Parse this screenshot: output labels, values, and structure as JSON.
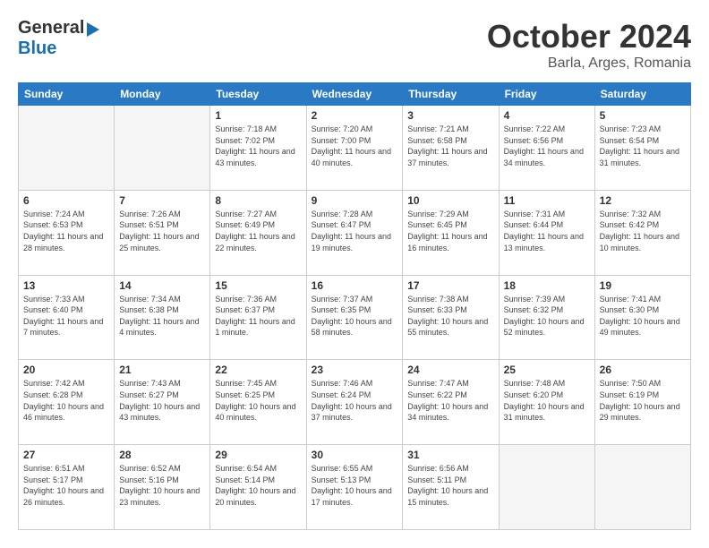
{
  "logo": {
    "general": "General",
    "blue": "Blue",
    "arrow": "arrow"
  },
  "header": {
    "month": "October 2024",
    "location": "Barla, Arges, Romania"
  },
  "days_of_week": [
    "Sunday",
    "Monday",
    "Tuesday",
    "Wednesday",
    "Thursday",
    "Friday",
    "Saturday"
  ],
  "weeks": [
    [
      {
        "day": "",
        "sunrise": "",
        "sunset": "",
        "daylight": "",
        "empty": true
      },
      {
        "day": "",
        "sunrise": "",
        "sunset": "",
        "daylight": "",
        "empty": true
      },
      {
        "day": "1",
        "sunrise": "Sunrise: 7:18 AM",
        "sunset": "Sunset: 7:02 PM",
        "daylight": "Daylight: 11 hours and 43 minutes.",
        "empty": false
      },
      {
        "day": "2",
        "sunrise": "Sunrise: 7:20 AM",
        "sunset": "Sunset: 7:00 PM",
        "daylight": "Daylight: 11 hours and 40 minutes.",
        "empty": false
      },
      {
        "day": "3",
        "sunrise": "Sunrise: 7:21 AM",
        "sunset": "Sunset: 6:58 PM",
        "daylight": "Daylight: 11 hours and 37 minutes.",
        "empty": false
      },
      {
        "day": "4",
        "sunrise": "Sunrise: 7:22 AM",
        "sunset": "Sunset: 6:56 PM",
        "daylight": "Daylight: 11 hours and 34 minutes.",
        "empty": false
      },
      {
        "day": "5",
        "sunrise": "Sunrise: 7:23 AM",
        "sunset": "Sunset: 6:54 PM",
        "daylight": "Daylight: 11 hours and 31 minutes.",
        "empty": false
      }
    ],
    [
      {
        "day": "6",
        "sunrise": "Sunrise: 7:24 AM",
        "sunset": "Sunset: 6:53 PM",
        "daylight": "Daylight: 11 hours and 28 minutes.",
        "empty": false
      },
      {
        "day": "7",
        "sunrise": "Sunrise: 7:26 AM",
        "sunset": "Sunset: 6:51 PM",
        "daylight": "Daylight: 11 hours and 25 minutes.",
        "empty": false
      },
      {
        "day": "8",
        "sunrise": "Sunrise: 7:27 AM",
        "sunset": "Sunset: 6:49 PM",
        "daylight": "Daylight: 11 hours and 22 minutes.",
        "empty": false
      },
      {
        "day": "9",
        "sunrise": "Sunrise: 7:28 AM",
        "sunset": "Sunset: 6:47 PM",
        "daylight": "Daylight: 11 hours and 19 minutes.",
        "empty": false
      },
      {
        "day": "10",
        "sunrise": "Sunrise: 7:29 AM",
        "sunset": "Sunset: 6:45 PM",
        "daylight": "Daylight: 11 hours and 16 minutes.",
        "empty": false
      },
      {
        "day": "11",
        "sunrise": "Sunrise: 7:31 AM",
        "sunset": "Sunset: 6:44 PM",
        "daylight": "Daylight: 11 hours and 13 minutes.",
        "empty": false
      },
      {
        "day": "12",
        "sunrise": "Sunrise: 7:32 AM",
        "sunset": "Sunset: 6:42 PM",
        "daylight": "Daylight: 11 hours and 10 minutes.",
        "empty": false
      }
    ],
    [
      {
        "day": "13",
        "sunrise": "Sunrise: 7:33 AM",
        "sunset": "Sunset: 6:40 PM",
        "daylight": "Daylight: 11 hours and 7 minutes.",
        "empty": false
      },
      {
        "day": "14",
        "sunrise": "Sunrise: 7:34 AM",
        "sunset": "Sunset: 6:38 PM",
        "daylight": "Daylight: 11 hours and 4 minutes.",
        "empty": false
      },
      {
        "day": "15",
        "sunrise": "Sunrise: 7:36 AM",
        "sunset": "Sunset: 6:37 PM",
        "daylight": "Daylight: 11 hours and 1 minute.",
        "empty": false
      },
      {
        "day": "16",
        "sunrise": "Sunrise: 7:37 AM",
        "sunset": "Sunset: 6:35 PM",
        "daylight": "Daylight: 10 hours and 58 minutes.",
        "empty": false
      },
      {
        "day": "17",
        "sunrise": "Sunrise: 7:38 AM",
        "sunset": "Sunset: 6:33 PM",
        "daylight": "Daylight: 10 hours and 55 minutes.",
        "empty": false
      },
      {
        "day": "18",
        "sunrise": "Sunrise: 7:39 AM",
        "sunset": "Sunset: 6:32 PM",
        "daylight": "Daylight: 10 hours and 52 minutes.",
        "empty": false
      },
      {
        "day": "19",
        "sunrise": "Sunrise: 7:41 AM",
        "sunset": "Sunset: 6:30 PM",
        "daylight": "Daylight: 10 hours and 49 minutes.",
        "empty": false
      }
    ],
    [
      {
        "day": "20",
        "sunrise": "Sunrise: 7:42 AM",
        "sunset": "Sunset: 6:28 PM",
        "daylight": "Daylight: 10 hours and 46 minutes.",
        "empty": false
      },
      {
        "day": "21",
        "sunrise": "Sunrise: 7:43 AM",
        "sunset": "Sunset: 6:27 PM",
        "daylight": "Daylight: 10 hours and 43 minutes.",
        "empty": false
      },
      {
        "day": "22",
        "sunrise": "Sunrise: 7:45 AM",
        "sunset": "Sunset: 6:25 PM",
        "daylight": "Daylight: 10 hours and 40 minutes.",
        "empty": false
      },
      {
        "day": "23",
        "sunrise": "Sunrise: 7:46 AM",
        "sunset": "Sunset: 6:24 PM",
        "daylight": "Daylight: 10 hours and 37 minutes.",
        "empty": false
      },
      {
        "day": "24",
        "sunrise": "Sunrise: 7:47 AM",
        "sunset": "Sunset: 6:22 PM",
        "daylight": "Daylight: 10 hours and 34 minutes.",
        "empty": false
      },
      {
        "day": "25",
        "sunrise": "Sunrise: 7:48 AM",
        "sunset": "Sunset: 6:20 PM",
        "daylight": "Daylight: 10 hours and 31 minutes.",
        "empty": false
      },
      {
        "day": "26",
        "sunrise": "Sunrise: 7:50 AM",
        "sunset": "Sunset: 6:19 PM",
        "daylight": "Daylight: 10 hours and 29 minutes.",
        "empty": false
      }
    ],
    [
      {
        "day": "27",
        "sunrise": "Sunrise: 6:51 AM",
        "sunset": "Sunset: 5:17 PM",
        "daylight": "Daylight: 10 hours and 26 minutes.",
        "empty": false
      },
      {
        "day": "28",
        "sunrise": "Sunrise: 6:52 AM",
        "sunset": "Sunset: 5:16 PM",
        "daylight": "Daylight: 10 hours and 23 minutes.",
        "empty": false
      },
      {
        "day": "29",
        "sunrise": "Sunrise: 6:54 AM",
        "sunset": "Sunset: 5:14 PM",
        "daylight": "Daylight: 10 hours and 20 minutes.",
        "empty": false
      },
      {
        "day": "30",
        "sunrise": "Sunrise: 6:55 AM",
        "sunset": "Sunset: 5:13 PM",
        "daylight": "Daylight: 10 hours and 17 minutes.",
        "empty": false
      },
      {
        "day": "31",
        "sunrise": "Sunrise: 6:56 AM",
        "sunset": "Sunset: 5:11 PM",
        "daylight": "Daylight: 10 hours and 15 minutes.",
        "empty": false
      },
      {
        "day": "",
        "sunrise": "",
        "sunset": "",
        "daylight": "",
        "empty": true
      },
      {
        "day": "",
        "sunrise": "",
        "sunset": "",
        "daylight": "",
        "empty": true
      }
    ]
  ]
}
